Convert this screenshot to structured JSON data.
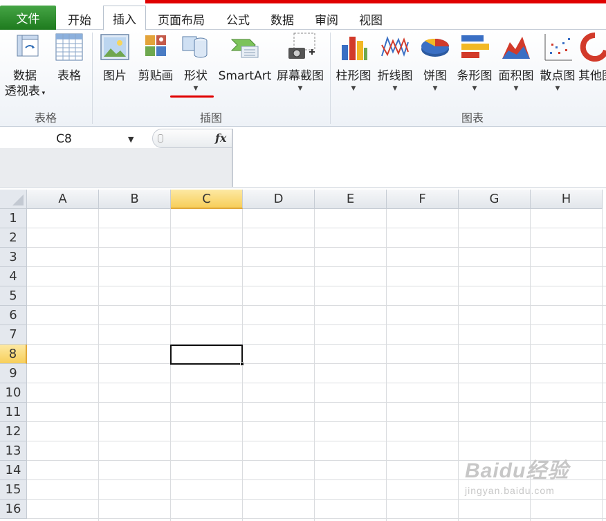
{
  "tabs": {
    "file": "文件",
    "items": [
      "开始",
      "插入",
      "页面布局",
      "公式",
      "数据",
      "审阅",
      "视图"
    ],
    "active": "插入"
  },
  "ribbon": {
    "groups": {
      "tables": "表格",
      "illustrations": "插图",
      "charts": "图表"
    },
    "buttons": {
      "pivot_line1": "数据",
      "pivot_line2": "透视表",
      "table": "表格",
      "picture": "图片",
      "clipart": "剪贴画",
      "shapes": "形状",
      "smartart": "SmartArt",
      "screenshot": "屏幕截图",
      "column": "柱形图",
      "line": "折线图",
      "pie": "饼图",
      "bar": "条形图",
      "area": "面积图",
      "scatter": "散点图",
      "other": "其他图"
    }
  },
  "formula_bar": {
    "name_box": "C8",
    "fx_label": "fx",
    "content": ""
  },
  "sheet": {
    "columns": [
      "A",
      "B",
      "C",
      "D",
      "E",
      "F",
      "G",
      "H"
    ],
    "rows": [
      "1",
      "2",
      "3",
      "4",
      "5",
      "6",
      "7",
      "8",
      "9",
      "10",
      "11",
      "12",
      "13",
      "14",
      "15",
      "16"
    ],
    "selected_column": "C",
    "selected_row": "8"
  },
  "watermark": {
    "logo": "Baidu经验",
    "url": "jingyan.baidu.com"
  },
  "colors": {
    "file_tab": "#2e8b2e",
    "selection_header": "#f7cf5a",
    "accent_red": "#e00000"
  }
}
